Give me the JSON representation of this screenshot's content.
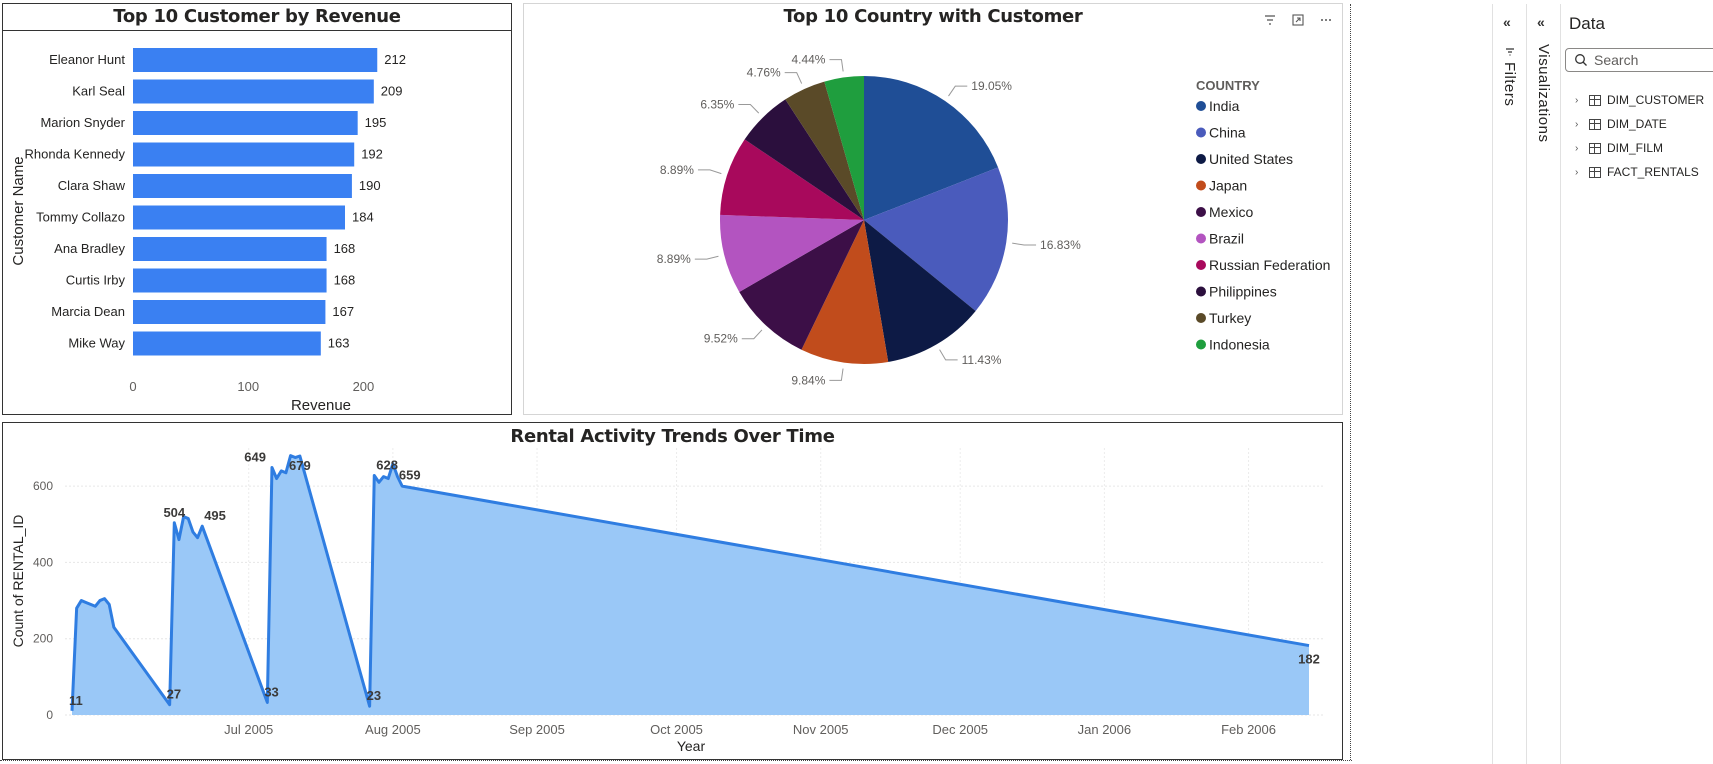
{
  "bar_visual": {
    "title": "Top 10 Customer by Revenue",
    "chart_data": {
      "type": "bar",
      "orientation": "horizontal",
      "title": "Top 10 Customer by Revenue",
      "xlabel": "Revenue",
      "ylabel": "Customer Name",
      "xlim": [
        0,
        230
      ],
      "xticks": [
        0,
        100,
        200
      ],
      "color": "#3a80f2",
      "categories": [
        "Eleanor Hunt",
        "Karl Seal",
        "Marion Snyder",
        "Rhonda Kennedy",
        "Clara Shaw",
        "Tommy Collazo",
        "Ana Bradley",
        "Curtis Irby",
        "Marcia Dean",
        "Mike Way"
      ],
      "values": [
        212,
        209,
        195,
        192,
        190,
        184,
        168,
        168,
        167,
        163
      ]
    }
  },
  "pie_visual": {
    "title": "Top 10 Country with Customer",
    "chart_data": {
      "type": "pie",
      "title": "Top 10 Country with Customer",
      "legend_title": "COUNTRY",
      "legend_position": "right",
      "slices": [
        {
          "label": "India",
          "value": 19.05,
          "display": "19.05%",
          "color": "#1f4e96"
        },
        {
          "label": "China",
          "value": 16.83,
          "display": "16.83%",
          "color": "#4a5bbc"
        },
        {
          "label": "United States",
          "value": 11.43,
          "display": "11.43%",
          "color": "#0d1a45"
        },
        {
          "label": "Japan",
          "value": 9.84,
          "display": "9.84%",
          "color": "#c14c1c"
        },
        {
          "label": "Mexico",
          "value": 9.52,
          "display": "9.52%",
          "color": "#3c0f47"
        },
        {
          "label": "Brazil",
          "value": 8.89,
          "display": "8.89%",
          "color": "#b354c0"
        },
        {
          "label": "Russian Federation",
          "value": 8.89,
          "display": "8.89%",
          "color": "#a8095c"
        },
        {
          "label": "Philippines",
          "value": 6.35,
          "display": "6.35%",
          "color": "#2b0f3d"
        },
        {
          "label": "Turkey",
          "value": 4.76,
          "display": "4.76%",
          "color": "#5a4a28"
        },
        {
          "label": "Indonesia",
          "value": 4.44,
          "display": "4.44%",
          "color": "#1f9e3e"
        }
      ]
    },
    "header_icons": [
      "filter-icon",
      "focus-mode-icon",
      "more-options-icon"
    ]
  },
  "area_visual": {
    "title": "Rental Activity Trends Over Time",
    "chart_data": {
      "type": "area",
      "title": "Rental Activity Trends Over Time",
      "xlabel": "Year",
      "ylabel": "Count of RENTAL_ID",
      "ylim": [
        0,
        700
      ],
      "yticks": [
        0,
        200,
        400,
        600
      ],
      "xticks": [
        "Jul 2005",
        "Aug 2005",
        "Sep 2005",
        "Oct 2005",
        "Nov 2005",
        "Dec 2005",
        "Jan 2006",
        "Feb 2006"
      ],
      "grid": true,
      "line_color": "#2f7de1",
      "fill_color": "#9ac8f7",
      "points": [
        {
          "x": "2005-05-24",
          "y": 11
        },
        {
          "x": "2005-05-25",
          "y": 280
        },
        {
          "x": "2005-05-26",
          "y": 300
        },
        {
          "x": "2005-05-27",
          "y": 295
        },
        {
          "x": "2005-05-28",
          "y": 290
        },
        {
          "x": "2005-05-29",
          "y": 285
        },
        {
          "x": "2005-05-30",
          "y": 300
        },
        {
          "x": "2005-05-31",
          "y": 305
        },
        {
          "x": "2005-06-01",
          "y": 290
        },
        {
          "x": "2005-06-02",
          "y": 230
        },
        {
          "x": "2005-06-14",
          "y": 27
        },
        {
          "x": "2005-06-15",
          "y": 504
        },
        {
          "x": "2005-06-16",
          "y": 460
        },
        {
          "x": "2005-06-17",
          "y": 520
        },
        {
          "x": "2005-06-18",
          "y": 515
        },
        {
          "x": "2005-06-19",
          "y": 480
        },
        {
          "x": "2005-06-20",
          "y": 465
        },
        {
          "x": "2005-06-21",
          "y": 495
        },
        {
          "x": "2005-07-05",
          "y": 33
        },
        {
          "x": "2005-07-06",
          "y": 649
        },
        {
          "x": "2005-07-07",
          "y": 620
        },
        {
          "x": "2005-07-08",
          "y": 640
        },
        {
          "x": "2005-07-09",
          "y": 635
        },
        {
          "x": "2005-07-10",
          "y": 680
        },
        {
          "x": "2005-07-11",
          "y": 675
        },
        {
          "x": "2005-07-12",
          "y": 679
        },
        {
          "x": "2005-07-27",
          "y": 23
        },
        {
          "x": "2005-07-28",
          "y": 628
        },
        {
          "x": "2005-07-29",
          "y": 610
        },
        {
          "x": "2005-07-30",
          "y": 625
        },
        {
          "x": "2005-07-31",
          "y": 620
        },
        {
          "x": "2005-08-01",
          "y": 659
        },
        {
          "x": "2005-08-02",
          "y": 625
        },
        {
          "x": "2005-08-03",
          "y": 600
        },
        {
          "x": "2006-02-14",
          "y": 182
        }
      ],
      "labels": [
        {
          "x": "2005-05-24",
          "y": 11,
          "text": "11"
        },
        {
          "x": "2005-06-14",
          "y": 27,
          "text": "27"
        },
        {
          "x": "2005-06-15",
          "y": 504,
          "text": "504"
        },
        {
          "x": "2005-06-21",
          "y": 495,
          "text": "495"
        },
        {
          "x": "2005-07-05",
          "y": 33,
          "text": "33"
        },
        {
          "x": "2005-07-06",
          "y": 649,
          "text": "649"
        },
        {
          "x": "2005-07-12",
          "y": 679,
          "text": "679"
        },
        {
          "x": "2005-07-27",
          "y": 23,
          "text": "23"
        },
        {
          "x": "2005-07-28",
          "y": 628,
          "text": "628"
        },
        {
          "x": "2005-08-01",
          "y": 659,
          "text": "659"
        },
        {
          "x": "2006-02-14",
          "y": 182,
          "text": "182"
        }
      ]
    }
  },
  "panes": {
    "filters_label": "Filters",
    "visualizations_label": "Visualizations",
    "data": {
      "title": "Data",
      "search_placeholder": "Search",
      "tables": [
        "DIM_CUSTOMER",
        "DIM_DATE",
        "DIM_FILM",
        "FACT_RENTALS"
      ]
    }
  }
}
